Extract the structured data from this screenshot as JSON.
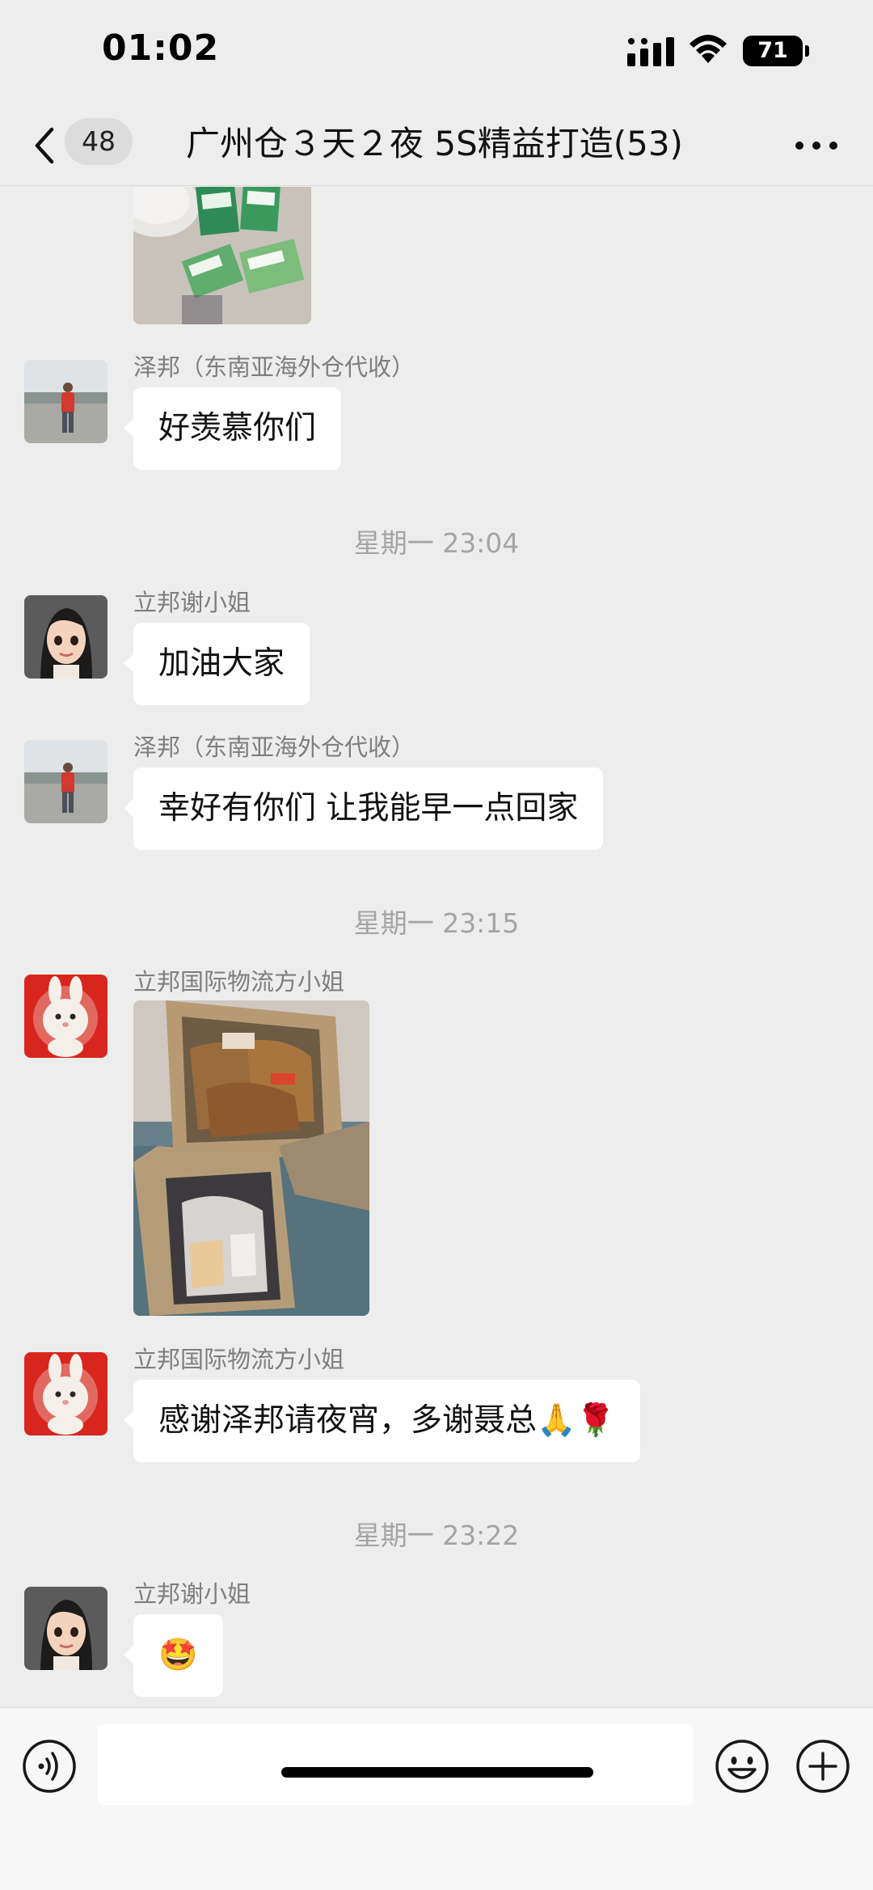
{
  "status_bar": {
    "time": "01:02",
    "battery": "71",
    "icons": [
      "cellular-signal-icon",
      "wifi-icon",
      "battery-icon"
    ]
  },
  "nav": {
    "back_icon": "chevron-left-icon",
    "unread_count": "48",
    "title": "广州仓３天２夜 5S精益打造(53)",
    "more_icon": "more-dots-icon"
  },
  "messages": [
    {
      "type": "image",
      "sender": "",
      "content": "photo-wet-wipe-packets"
    },
    {
      "type": "text",
      "sender": "泽邦（东南亚海外仓代收）",
      "text": "好羡慕你们"
    },
    {
      "type": "time",
      "text": "星期一 23:04"
    },
    {
      "type": "text",
      "sender": "立邦谢小姐",
      "text": "加油大家"
    },
    {
      "type": "text",
      "sender": "泽邦（东南亚海外仓代收）",
      "text": "幸好有你们 让我能早一点回家"
    },
    {
      "type": "time",
      "text": "星期一 23:15"
    },
    {
      "type": "image",
      "sender": "立邦国际物流方小姐",
      "content": "photo-cardboard-boxes-of-snacks"
    },
    {
      "type": "text",
      "sender": "立邦国际物流方小姐",
      "text": "感谢泽邦请夜宵，多谢聂总🙏🌹"
    },
    {
      "type": "time",
      "text": "星期一 23:22"
    },
    {
      "type": "text",
      "sender": "立邦谢小姐",
      "text": "🤩"
    }
  ],
  "input_bar": {
    "voice_icon": "voice-icon",
    "message_placeholder": "",
    "emoji_icon": "emoji-icon",
    "plus_icon": "plus-circle-icon"
  },
  "colors": {
    "background": "#ededed",
    "bubble": "#ffffff",
    "sender_name": "#7e7e7e",
    "timestamp": "#a4a4a4"
  }
}
